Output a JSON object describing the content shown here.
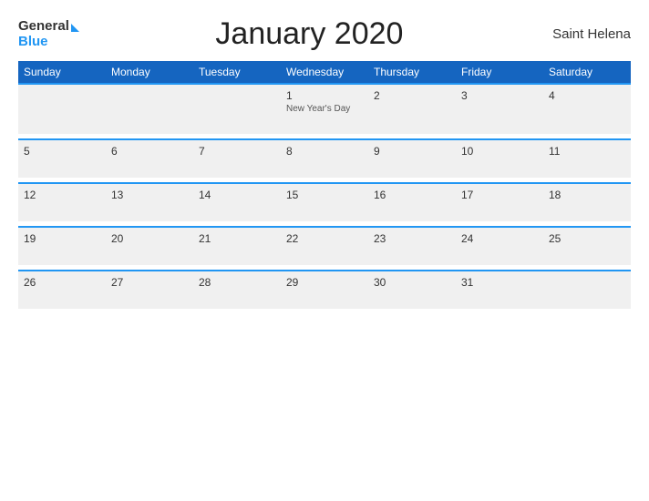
{
  "header": {
    "logo_general": "General",
    "logo_blue": "Blue",
    "title": "January 2020",
    "region": "Saint Helena"
  },
  "days_of_week": [
    "Sunday",
    "Monday",
    "Tuesday",
    "Wednesday",
    "Thursday",
    "Friday",
    "Saturday"
  ],
  "weeks": [
    [
      {
        "day": "",
        "event": ""
      },
      {
        "day": "",
        "event": ""
      },
      {
        "day": "",
        "event": ""
      },
      {
        "day": "1",
        "event": "New Year's Day"
      },
      {
        "day": "2",
        "event": ""
      },
      {
        "day": "3",
        "event": ""
      },
      {
        "day": "4",
        "event": ""
      }
    ],
    [
      {
        "day": "5",
        "event": ""
      },
      {
        "day": "6",
        "event": ""
      },
      {
        "day": "7",
        "event": ""
      },
      {
        "day": "8",
        "event": ""
      },
      {
        "day": "9",
        "event": ""
      },
      {
        "day": "10",
        "event": ""
      },
      {
        "day": "11",
        "event": ""
      }
    ],
    [
      {
        "day": "12",
        "event": ""
      },
      {
        "day": "13",
        "event": ""
      },
      {
        "day": "14",
        "event": ""
      },
      {
        "day": "15",
        "event": ""
      },
      {
        "day": "16",
        "event": ""
      },
      {
        "day": "17",
        "event": ""
      },
      {
        "day": "18",
        "event": ""
      }
    ],
    [
      {
        "day": "19",
        "event": ""
      },
      {
        "day": "20",
        "event": ""
      },
      {
        "day": "21",
        "event": ""
      },
      {
        "day": "22",
        "event": ""
      },
      {
        "day": "23",
        "event": ""
      },
      {
        "day": "24",
        "event": ""
      },
      {
        "day": "25",
        "event": ""
      }
    ],
    [
      {
        "day": "26",
        "event": ""
      },
      {
        "day": "27",
        "event": ""
      },
      {
        "day": "28",
        "event": ""
      },
      {
        "day": "29",
        "event": ""
      },
      {
        "day": "30",
        "event": ""
      },
      {
        "day": "31",
        "event": ""
      },
      {
        "day": "",
        "event": ""
      }
    ]
  ]
}
